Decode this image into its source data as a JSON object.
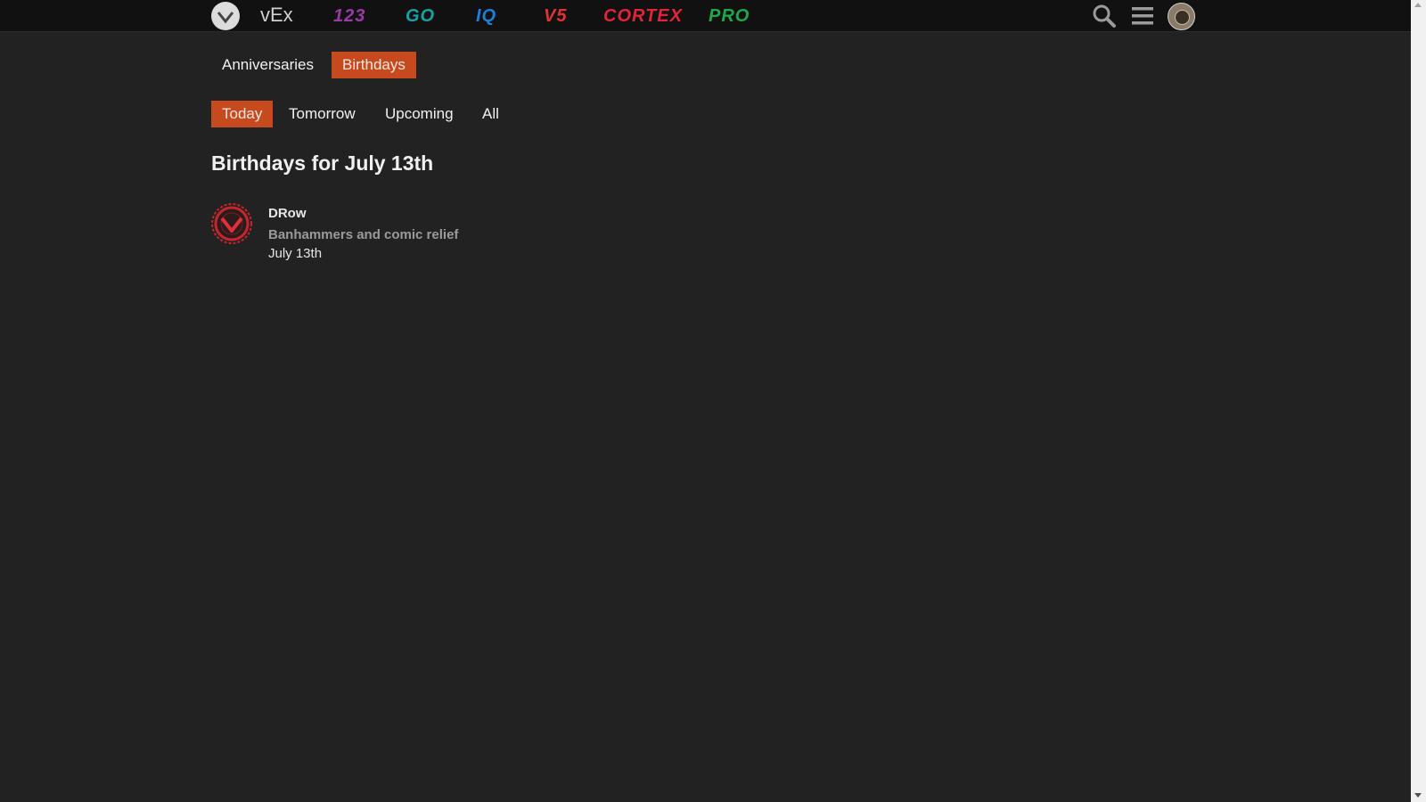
{
  "header": {
    "brands": [
      {
        "label": "vEx",
        "color": "#d0d0d0"
      },
      {
        "label": "123",
        "color": "#9b3aa7"
      },
      {
        "label": "GO",
        "color": "#17a2a6"
      },
      {
        "label": "IQ",
        "color": "#1f7fd8"
      },
      {
        "label": "V5",
        "color": "#e23234"
      },
      {
        "label": "CORTEX",
        "color": "#e2243a"
      },
      {
        "label": "PRO",
        "color": "#1fa84a"
      }
    ],
    "icons": {
      "logo": "vex-logo-icon",
      "search": "search-icon",
      "menu": "hamburger-menu-icon",
      "avatar": "user-avatar"
    }
  },
  "tabs": {
    "primary": [
      {
        "label": "Anniversaries",
        "active": false
      },
      {
        "label": "Birthdays",
        "active": true
      }
    ],
    "secondary": [
      {
        "label": "Today",
        "active": true
      },
      {
        "label": "Tomorrow",
        "active": false
      },
      {
        "label": "Upcoming",
        "active": false
      },
      {
        "label": "All",
        "active": false
      }
    ]
  },
  "page": {
    "title": "Birthdays for July 13th"
  },
  "entries": [
    {
      "name": "DRow",
      "title": "Banhammers and comic relief",
      "date": "July 13th",
      "avatar_icon": "vex-gear-logo-icon"
    }
  ],
  "colors": {
    "background": "#222222",
    "header": "#111111",
    "accent": "#c64a1e",
    "muted_text": "#9a9a9a"
  }
}
